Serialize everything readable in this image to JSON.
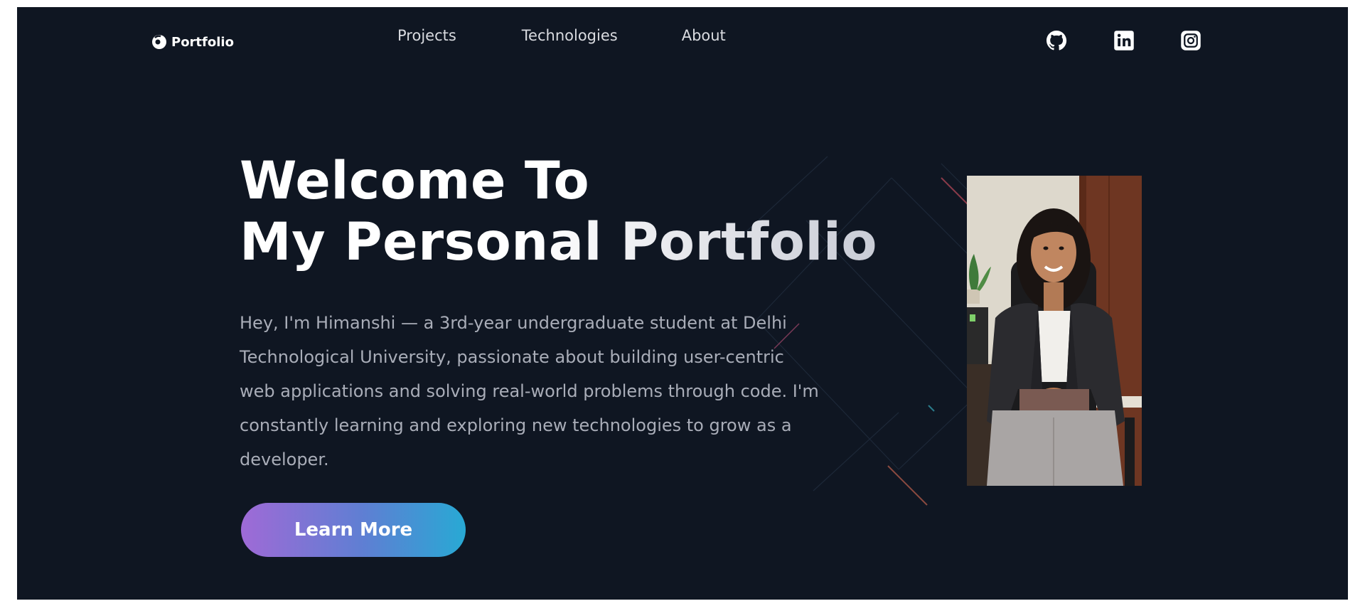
{
  "nav": {
    "logo_text": "Portfolio",
    "links": [
      {
        "label": "Projects"
      },
      {
        "label": "Technologies"
      },
      {
        "label": "About"
      }
    ],
    "social_icons": [
      "github-icon",
      "linkedin-icon",
      "instagram-icon"
    ]
  },
  "hero": {
    "title_line1": "Welcome To",
    "title_line2": "My Personal Portfolio",
    "description": "Hey, I'm Himanshi — a 3rd-year undergraduate student at Delhi Technological University, passionate about building user-centric web applications and solving real-world problems through code. I'm constantly learning and exploring new technologies to grow as a developer.",
    "cta_label": "Learn More"
  },
  "colors": {
    "background": "#0f1622",
    "button_gradient_start": "#9f6ad6",
    "button_gradient_end": "#28a9d4"
  }
}
